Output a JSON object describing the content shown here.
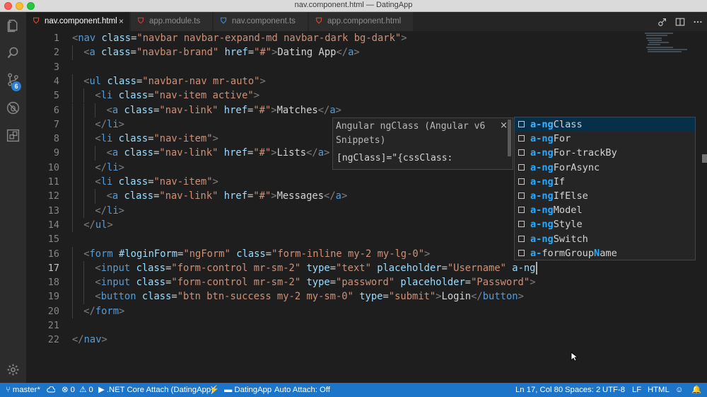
{
  "window": {
    "title": "nav.component.html — DatingApp"
  },
  "activity_bar": {
    "items": [
      {
        "name": "explorer",
        "icon": "files-icon"
      },
      {
        "name": "search",
        "icon": "search-icon"
      },
      {
        "name": "source-control",
        "icon": "git-branch-icon",
        "badge": "6"
      },
      {
        "name": "debug",
        "icon": "debug-icon"
      },
      {
        "name": "extensions",
        "icon": "extensions-icon"
      }
    ],
    "settings_icon": "gear-icon"
  },
  "tabs": [
    {
      "label": "nav.component.html",
      "icon": "html-file-icon",
      "active": true,
      "close": "×"
    },
    {
      "label": "app.module.ts",
      "icon": "angular-icon",
      "active": false
    },
    {
      "label": "nav.component.ts",
      "icon": "angular-icon",
      "active": false
    },
    {
      "label": "app.component.html",
      "icon": "html-file-icon",
      "active": false
    }
  ],
  "editor_actions": [
    "open-changes-icon",
    "split-editor-icon",
    "more-icon"
  ],
  "line_numbers": [
    "1",
    "2",
    "3",
    "4",
    "5",
    "6",
    "7",
    "8",
    "9",
    "10",
    "11",
    "12",
    "13",
    "14",
    "15",
    "16",
    "17",
    "18",
    "19",
    "20",
    "21",
    "22"
  ],
  "current_line": "17",
  "code_lines": [
    {
      "indent": 0,
      "tokens": [
        [
          "p",
          "<"
        ],
        [
          "t",
          "nav"
        ],
        [
          "x",
          " "
        ],
        [
          "a",
          "class"
        ],
        [
          "x",
          "="
        ],
        [
          "s",
          "\"navbar navbar-expand-md navbar-dark bg-dark\""
        ],
        [
          "p",
          ">"
        ]
      ]
    },
    {
      "indent": 1,
      "tokens": [
        [
          "p",
          "<"
        ],
        [
          "t",
          "a"
        ],
        [
          "x",
          " "
        ],
        [
          "a",
          "class"
        ],
        [
          "x",
          "="
        ],
        [
          "s",
          "\"navbar-brand\""
        ],
        [
          "x",
          " "
        ],
        [
          "a",
          "href"
        ],
        [
          "x",
          "="
        ],
        [
          "s",
          "\"#\""
        ],
        [
          "p",
          ">"
        ],
        [
          "x",
          "Dating App"
        ],
        [
          "p",
          "</"
        ],
        [
          "t",
          "a"
        ],
        [
          "p",
          ">"
        ]
      ]
    },
    {
      "indent": 0,
      "tokens": []
    },
    {
      "indent": 1,
      "tokens": [
        [
          "p",
          "<"
        ],
        [
          "t",
          "ul"
        ],
        [
          "x",
          " "
        ],
        [
          "a",
          "class"
        ],
        [
          "x",
          "="
        ],
        [
          "s",
          "\"navbar-nav mr-auto\""
        ],
        [
          "p",
          ">"
        ]
      ]
    },
    {
      "indent": 2,
      "tokens": [
        [
          "p",
          "<"
        ],
        [
          "t",
          "li"
        ],
        [
          "x",
          " "
        ],
        [
          "a",
          "class"
        ],
        [
          "x",
          "="
        ],
        [
          "s",
          "\"nav-item active\""
        ],
        [
          "p",
          ">"
        ]
      ]
    },
    {
      "indent": 3,
      "tokens": [
        [
          "p",
          "<"
        ],
        [
          "t",
          "a"
        ],
        [
          "x",
          " "
        ],
        [
          "a",
          "class"
        ],
        [
          "x",
          "="
        ],
        [
          "s",
          "\"nav-link\""
        ],
        [
          "x",
          " "
        ],
        [
          "a",
          "href"
        ],
        [
          "x",
          "="
        ],
        [
          "s",
          "\"#\""
        ],
        [
          "p",
          ">"
        ],
        [
          "x",
          "Matches"
        ],
        [
          "p",
          "</"
        ],
        [
          "t",
          "a"
        ],
        [
          "p",
          ">"
        ]
      ]
    },
    {
      "indent": 2,
      "tokens": [
        [
          "p",
          "</"
        ],
        [
          "t",
          "li"
        ],
        [
          "p",
          ">"
        ]
      ]
    },
    {
      "indent": 2,
      "tokens": [
        [
          "p",
          "<"
        ],
        [
          "t",
          "li"
        ],
        [
          "x",
          " "
        ],
        [
          "a",
          "class"
        ],
        [
          "x",
          "="
        ],
        [
          "s",
          "\"nav-item\""
        ],
        [
          "p",
          ">"
        ]
      ]
    },
    {
      "indent": 3,
      "tokens": [
        [
          "p",
          "<"
        ],
        [
          "t",
          "a"
        ],
        [
          "x",
          " "
        ],
        [
          "a",
          "class"
        ],
        [
          "x",
          "="
        ],
        [
          "s",
          "\"nav-link\""
        ],
        [
          "x",
          " "
        ],
        [
          "a",
          "href"
        ],
        [
          "x",
          "="
        ],
        [
          "s",
          "\"#\""
        ],
        [
          "p",
          ">"
        ],
        [
          "x",
          "Lists"
        ],
        [
          "p",
          "</"
        ],
        [
          "t",
          "a"
        ],
        [
          "p",
          ">"
        ]
      ]
    },
    {
      "indent": 2,
      "tokens": [
        [
          "p",
          "</"
        ],
        [
          "t",
          "li"
        ],
        [
          "p",
          ">"
        ]
      ]
    },
    {
      "indent": 2,
      "tokens": [
        [
          "p",
          "<"
        ],
        [
          "t",
          "li"
        ],
        [
          "x",
          " "
        ],
        [
          "a",
          "class"
        ],
        [
          "x",
          "="
        ],
        [
          "s",
          "\"nav-item\""
        ],
        [
          "p",
          ">"
        ]
      ]
    },
    {
      "indent": 3,
      "tokens": [
        [
          "p",
          "<"
        ],
        [
          "t",
          "a"
        ],
        [
          "x",
          " "
        ],
        [
          "a",
          "class"
        ],
        [
          "x",
          "="
        ],
        [
          "s",
          "\"nav-link\""
        ],
        [
          "x",
          " "
        ],
        [
          "a",
          "href"
        ],
        [
          "x",
          "="
        ],
        [
          "s",
          "\"#\""
        ],
        [
          "p",
          ">"
        ],
        [
          "x",
          "Messages"
        ],
        [
          "p",
          "</"
        ],
        [
          "t",
          "a"
        ],
        [
          "p",
          ">"
        ]
      ]
    },
    {
      "indent": 2,
      "tokens": [
        [
          "p",
          "</"
        ],
        [
          "t",
          "li"
        ],
        [
          "p",
          ">"
        ]
      ]
    },
    {
      "indent": 1,
      "tokens": [
        [
          "p",
          "</"
        ],
        [
          "t",
          "ul"
        ],
        [
          "p",
          ">"
        ]
      ]
    },
    {
      "indent": 0,
      "tokens": []
    },
    {
      "indent": 1,
      "tokens": [
        [
          "p",
          "<"
        ],
        [
          "t",
          "form"
        ],
        [
          "x",
          " "
        ],
        [
          "a",
          "#loginForm"
        ],
        [
          "x",
          "="
        ],
        [
          "s",
          "\"ngForm\""
        ],
        [
          "x",
          " "
        ],
        [
          "a",
          "class"
        ],
        [
          "x",
          "="
        ],
        [
          "s",
          "\"form-inline my-2 my-lg-0\""
        ],
        [
          "p",
          ">"
        ]
      ]
    },
    {
      "indent": 2,
      "tokens": [
        [
          "p",
          "<"
        ],
        [
          "t",
          "input"
        ],
        [
          "x",
          " "
        ],
        [
          "a",
          "class"
        ],
        [
          "x",
          "="
        ],
        [
          "s",
          "\"form-control mr-sm-2\""
        ],
        [
          "x",
          " "
        ],
        [
          "a",
          "type"
        ],
        [
          "x",
          "="
        ],
        [
          "s",
          "\"text\""
        ],
        [
          "x",
          " "
        ],
        [
          "a",
          "placeholder"
        ],
        [
          "x",
          "="
        ],
        [
          "s",
          "\"Username\""
        ],
        [
          "x",
          " "
        ],
        [
          "a",
          "a-ng"
        ]
      ]
    },
    {
      "indent": 2,
      "tokens": [
        [
          "p",
          "<"
        ],
        [
          "t",
          "input"
        ],
        [
          "x",
          " "
        ],
        [
          "a",
          "class"
        ],
        [
          "x",
          "="
        ],
        [
          "s",
          "\"form-control mr-sm-2\""
        ],
        [
          "x",
          " "
        ],
        [
          "a",
          "type"
        ],
        [
          "x",
          "="
        ],
        [
          "s",
          "\"password\""
        ],
        [
          "x",
          " "
        ],
        [
          "a",
          "placeholder"
        ],
        [
          "x",
          "="
        ],
        [
          "s",
          "\"Password\""
        ],
        [
          "p",
          ">"
        ]
      ]
    },
    {
      "indent": 2,
      "tokens": [
        [
          "p",
          "<"
        ],
        [
          "t",
          "button"
        ],
        [
          "x",
          " "
        ],
        [
          "a",
          "class"
        ],
        [
          "x",
          "="
        ],
        [
          "s",
          "\"btn btn-success my-2 my-sm-0\""
        ],
        [
          "x",
          " "
        ],
        [
          "a",
          "type"
        ],
        [
          "x",
          "="
        ],
        [
          "s",
          "\"submit\""
        ],
        [
          "p",
          ">"
        ],
        [
          "x",
          "Login"
        ],
        [
          "p",
          "</"
        ],
        [
          "t",
          "button"
        ],
        [
          "p",
          ">"
        ]
      ]
    },
    {
      "indent": 1,
      "tokens": [
        [
          "p",
          "</"
        ],
        [
          "t",
          "form"
        ],
        [
          "p",
          ">"
        ]
      ]
    },
    {
      "indent": 0,
      "tokens": []
    },
    {
      "indent": 0,
      "tokens": [
        [
          "p",
          "</"
        ],
        [
          "t",
          "nav"
        ],
        [
          "p",
          ">"
        ]
      ]
    }
  ],
  "hover_widget": {
    "title": "Angular ngClass (Angular v6 Snippets)",
    "body": "[ngClass]=\"{cssClass:",
    "close": "×"
  },
  "suggestions": [
    {
      "match": "a-ng",
      "rest": "Class",
      "selected": true
    },
    {
      "match": "a-ng",
      "rest": "For",
      "selected": false
    },
    {
      "match": "a-ng",
      "rest": "For-trackBy",
      "selected": false
    },
    {
      "match": "a-ng",
      "rest": "ForAsync",
      "selected": false
    },
    {
      "match": "a-ng",
      "rest": "If",
      "selected": false
    },
    {
      "match": "a-ng",
      "rest": "IfElse",
      "selected": false
    },
    {
      "match": "a-ng",
      "rest": "Model",
      "selected": false
    },
    {
      "match": "a-ng",
      "rest": "Style",
      "selected": false
    },
    {
      "match": "a-ng",
      "rest": "Switch",
      "selected": false
    },
    {
      "match": "a-formGroupName",
      "rest": "",
      "selected": false
    }
  ],
  "status_bar": {
    "branch": "master*",
    "errors": "0",
    "warnings": "0",
    "debug_config": ".NET Core Attach (DatingApp)",
    "folder": "DatingApp",
    "auto_attach": "Auto Attach: Off",
    "position": "Ln 17, Col 80",
    "spaces": "Spaces: 2",
    "encoding": "UTF-8",
    "eol": "LF",
    "language": "HTML"
  },
  "colors": {
    "status_bar": "#1c75c9",
    "editor_bg": "#1e1e1e",
    "tag": "#569cd6",
    "attribute": "#9cdcfe",
    "string": "#ce9178",
    "match_highlight": "#2aaaff"
  }
}
